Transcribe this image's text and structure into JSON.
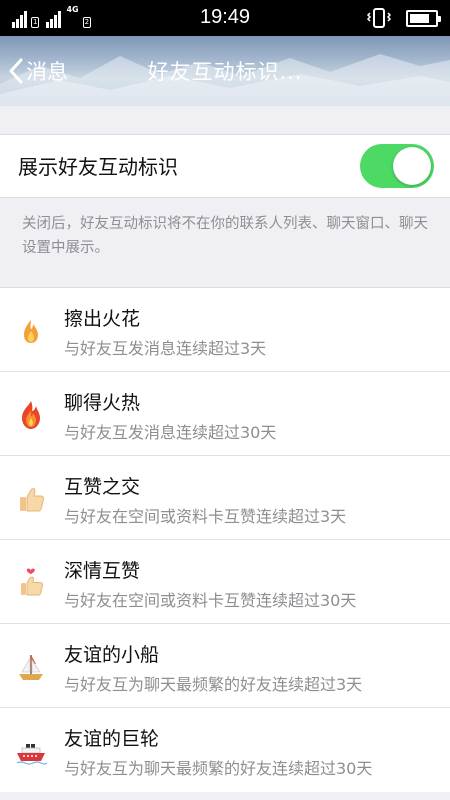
{
  "status_bar": {
    "time": "19:49",
    "sim1": "1",
    "sim2": "2",
    "network": "4G",
    "battery_level": 0.8,
    "icons": [
      "signal-icon",
      "vibrate-icon",
      "battery-icon"
    ]
  },
  "nav": {
    "back_label": "消息",
    "title": "好友互动标识..."
  },
  "toggle": {
    "label": "展示好友互动标识",
    "enabled": true,
    "accent_color": "#4cd964"
  },
  "hint": "关闭后，好友互动标识将不在你的联系人列表、聊天窗口、聊天设置中展示。",
  "items": [
    {
      "icon": "small-flame-icon",
      "title": "擦出火花",
      "subtitle": "与好友互发消息连续超过3天"
    },
    {
      "icon": "big-fire-icon",
      "title": "聊得火热",
      "subtitle": "与好友互发消息连续超过30天"
    },
    {
      "icon": "thumbs-up-icon",
      "title": "互赞之交",
      "subtitle": "与好友在空间或资料卡互赞连续超过3天"
    },
    {
      "icon": "thumbs-up-heart-icon",
      "title": "深情互赞",
      "subtitle": "与好友在空间或资料卡互赞连续超过30天"
    },
    {
      "icon": "sailboat-icon",
      "title": "友谊的小船",
      "subtitle": "与好友互为聊天最频繁的好友连续超过3天"
    },
    {
      "icon": "cruise-ship-icon",
      "title": "友谊的巨轮",
      "subtitle": "与好友互为聊天最频繁的好友连续超过30天"
    }
  ]
}
